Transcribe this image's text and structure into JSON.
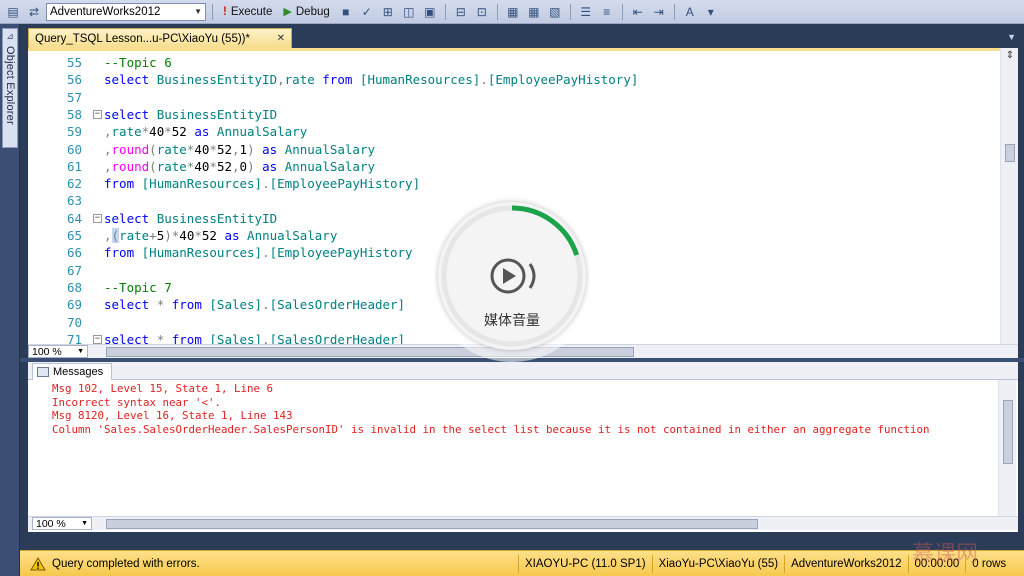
{
  "toolbar": {
    "database": "AdventureWorks2012",
    "execute_label": "Execute",
    "debug_label": "Debug"
  },
  "sidebar": {
    "object_explorer_label": "Object Explorer"
  },
  "document_tab": {
    "title": "Query_TSQL Lesson...u-PC\\XiaoYu (55))*",
    "close_glyph": "✕"
  },
  "editor": {
    "zoom": "100 %",
    "lines": [
      {
        "num": "55",
        "fold": false,
        "tokens": [
          {
            "t": "--Topic 6",
            "c": "comment"
          }
        ]
      },
      {
        "num": "56",
        "fold": false,
        "tokens": [
          {
            "t": "select ",
            "c": "kw"
          },
          {
            "t": "BusinessEntityID",
            "c": "id"
          },
          {
            "t": ",",
            "c": "op"
          },
          {
            "t": "rate ",
            "c": "id"
          },
          {
            "t": "from ",
            "c": "kw"
          },
          {
            "t": "[HumanResources]",
            "c": "id"
          },
          {
            "t": ".",
            "c": "op"
          },
          {
            "t": "[EmployeePayHistory]",
            "c": "id"
          }
        ]
      },
      {
        "num": "57",
        "fold": false,
        "tokens": []
      },
      {
        "num": "58",
        "fold": true,
        "tokens": [
          {
            "t": "select ",
            "c": "kw"
          },
          {
            "t": "BusinessEntityID",
            "c": "id"
          }
        ]
      },
      {
        "num": "59",
        "fold": false,
        "tokens": [
          {
            "t": ",",
            "c": "op"
          },
          {
            "t": "rate",
            "c": "id"
          },
          {
            "t": "*",
            "c": "op"
          },
          {
            "t": "40",
            "c": "plain"
          },
          {
            "t": "*",
            "c": "op"
          },
          {
            "t": "52 ",
            "c": "plain"
          },
          {
            "t": "as ",
            "c": "kw"
          },
          {
            "t": "AnnualSalary",
            "c": "id"
          }
        ]
      },
      {
        "num": "60",
        "fold": false,
        "tokens": [
          {
            "t": ",",
            "c": "op"
          },
          {
            "t": "round",
            "c": "fn"
          },
          {
            "t": "(",
            "c": "op"
          },
          {
            "t": "rate",
            "c": "id"
          },
          {
            "t": "*",
            "c": "op"
          },
          {
            "t": "40",
            "c": "plain"
          },
          {
            "t": "*",
            "c": "op"
          },
          {
            "t": "52",
            "c": "plain"
          },
          {
            "t": ",",
            "c": "op"
          },
          {
            "t": "1",
            "c": "plain"
          },
          {
            "t": ") ",
            "c": "op"
          },
          {
            "t": "as ",
            "c": "kw"
          },
          {
            "t": "AnnualSalary",
            "c": "id"
          }
        ]
      },
      {
        "num": "61",
        "fold": false,
        "tokens": [
          {
            "t": ",",
            "c": "op"
          },
          {
            "t": "round",
            "c": "fn"
          },
          {
            "t": "(",
            "c": "op"
          },
          {
            "t": "rate",
            "c": "id"
          },
          {
            "t": "*",
            "c": "op"
          },
          {
            "t": "40",
            "c": "plain"
          },
          {
            "t": "*",
            "c": "op"
          },
          {
            "t": "52",
            "c": "plain"
          },
          {
            "t": ",",
            "c": "op"
          },
          {
            "t": "0",
            "c": "plain"
          },
          {
            "t": ") ",
            "c": "op"
          },
          {
            "t": "as ",
            "c": "kw"
          },
          {
            "t": "AnnualSalary",
            "c": "id"
          }
        ]
      },
      {
        "num": "62",
        "fold": false,
        "tokens": [
          {
            "t": "from ",
            "c": "kw"
          },
          {
            "t": "[HumanResources]",
            "c": "id"
          },
          {
            "t": ".",
            "c": "op"
          },
          {
            "t": "[EmployeePayHistory]",
            "c": "id"
          }
        ]
      },
      {
        "num": "63",
        "fold": false,
        "tokens": []
      },
      {
        "num": "64",
        "fold": true,
        "tokens": [
          {
            "t": "select ",
            "c": "kw"
          },
          {
            "t": "BusinessEntityID",
            "c": "id"
          }
        ]
      },
      {
        "num": "65",
        "fold": false,
        "tokens": [
          {
            "t": ",",
            "c": "op"
          },
          {
            "t": "(",
            "c": "op highlight"
          },
          {
            "t": "rate",
            "c": "id"
          },
          {
            "t": "+",
            "c": "op"
          },
          {
            "t": "5",
            "c": "plain"
          },
          {
            "t": ")",
            "c": "op"
          },
          {
            "t": "*",
            "c": "op"
          },
          {
            "t": "40",
            "c": "plain"
          },
          {
            "t": "*",
            "c": "op"
          },
          {
            "t": "52 ",
            "c": "plain"
          },
          {
            "t": "as ",
            "c": "kw"
          },
          {
            "t": "AnnualSalary",
            "c": "id"
          }
        ]
      },
      {
        "num": "66",
        "fold": false,
        "tokens": [
          {
            "t": "from ",
            "c": "kw"
          },
          {
            "t": "[HumanResources]",
            "c": "id"
          },
          {
            "t": ".",
            "c": "op"
          },
          {
            "t": "[EmployeePayHistory",
            "c": "id"
          }
        ]
      },
      {
        "num": "67",
        "fold": false,
        "tokens": []
      },
      {
        "num": "68",
        "fold": false,
        "tokens": [
          {
            "t": "--Topic 7",
            "c": "comment"
          }
        ]
      },
      {
        "num": "69",
        "fold": false,
        "tokens": [
          {
            "t": "select ",
            "c": "kw"
          },
          {
            "t": "* ",
            "c": "op"
          },
          {
            "t": "from ",
            "c": "kw"
          },
          {
            "t": "[Sales]",
            "c": "id"
          },
          {
            "t": ".",
            "c": "op"
          },
          {
            "t": "[SalesOrderHeader]",
            "c": "id"
          }
        ]
      },
      {
        "num": "70",
        "fold": false,
        "tokens": []
      },
      {
        "num": "71",
        "fold": true,
        "tokens": [
          {
            "t": "select ",
            "c": "kw"
          },
          {
            "t": "* ",
            "c": "op"
          },
          {
            "t": "from ",
            "c": "kw"
          },
          {
            "t": "[Sales]",
            "c": "id"
          },
          {
            "t": ".",
            "c": "op"
          },
          {
            "t": "[SalesOrderHeader]",
            "c": "id"
          }
        ]
      }
    ]
  },
  "messages": {
    "tab_label": "Messages",
    "zoom": "100 %",
    "lines": [
      "Msg 102, Level 15, State 1, Line 6",
      "Incorrect syntax near '<'.",
      "Msg 8120, Level 16, State 1, Line 143",
      "Column 'Sales.SalesOrderHeader.SalesPersonID' is invalid in the select list because it is not contained in either an aggregate function"
    ]
  },
  "status": {
    "message": "Query completed with errors.",
    "server": "XIAOYU-PC (11.0 SP1)",
    "user": "XiaoYu-PC\\XiaoYu (55)",
    "database": "AdventureWorks2012",
    "time": "00:00:00",
    "rows": "0 rows"
  },
  "overlay": {
    "label": "媒体音量",
    "level": 0.2,
    "accent": "#1aa34a"
  },
  "watermark": "慕课网",
  "colors": {
    "keyword": "#0000ff",
    "comment": "#008000",
    "identifier": "#008080",
    "function": "#ff00ff",
    "error": "#e02020",
    "status_bg": "#f6c94d"
  }
}
